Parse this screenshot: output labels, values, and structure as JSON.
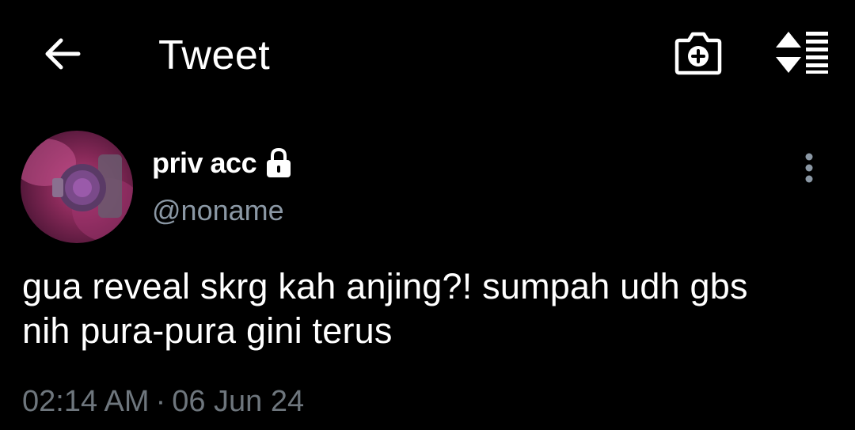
{
  "header": {
    "title": "Tweet"
  },
  "tweet": {
    "display_name": "priv acc",
    "username": "@noname",
    "text_line1": "gua reveal skrg kah anjing?! sumpah udh gbs",
    "text_line2": "nih pura-pura gini terus",
    "time": "02:14 AM",
    "separator": "·",
    "date": "06 Jun 24"
  },
  "icons": {
    "back": "arrow-left-icon",
    "camera": "camera-plus-icon",
    "sort": "sort-icon",
    "lock": "lock-icon",
    "more": "more-vertical-icon"
  },
  "colors": {
    "background": "#000000",
    "primary_text": "#ffffff",
    "secondary_text": "#8b98a5",
    "meta_text": "#6e767d"
  }
}
